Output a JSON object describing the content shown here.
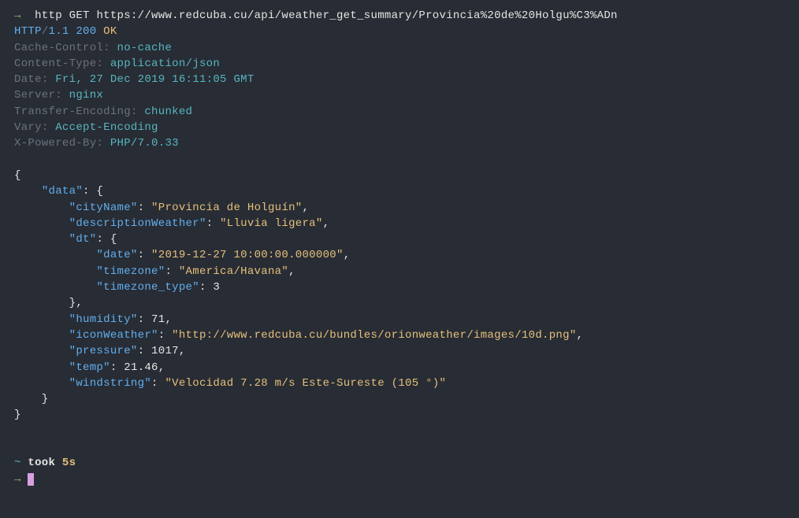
{
  "command": {
    "prompt_arrow": "→",
    "tool": "http",
    "method": "GET",
    "url": "https://www.redcuba.cu/api/weather_get_summary/Provincia%20de%20Holgu%C3%ADn"
  },
  "status_line": {
    "protocol": "HTTP",
    "slash": "/",
    "version": "1.1",
    "code": "200",
    "reason": "OK"
  },
  "headers": {
    "cache_control": {
      "key": "Cache-Control",
      "value": "no-cache"
    },
    "content_type": {
      "key": "Content-Type",
      "value": "application/json"
    },
    "date": {
      "key": "Date",
      "value": "Fri, 27 Dec 2019 16:11:05 GMT"
    },
    "server": {
      "key": "Server",
      "value": "nginx"
    },
    "transfer_encoding": {
      "key": "Transfer-Encoding",
      "value": "chunked"
    },
    "vary": {
      "key": "Vary",
      "value": "Accept-Encoding"
    },
    "x_powered_by": {
      "key": "X-Powered-By",
      "value": "PHP/7.0.33"
    }
  },
  "body": {
    "open_brace": "{",
    "close_brace": "}",
    "indent1": "    ",
    "indent2": "        ",
    "indent3": "            ",
    "data_key": "\"data\"",
    "colon_brace": ": {",
    "cityName_key": "\"cityName\"",
    "cityName_val": "\"Provincia de Holguín\"",
    "descWeather_key": "\"descriptionWeather\"",
    "descWeather_val": "\"Lluvia ligera\"",
    "dt_key": "\"dt\"",
    "date_key": "\"date\"",
    "date_val": "\"2019-12-27 10:00:00.000000\"",
    "timezone_key": "\"timezone\"",
    "timezone_val": "\"America/Havana\"",
    "timezone_type_key": "\"timezone_type\"",
    "timezone_type_val": "3",
    "close_brace_comma": "},",
    "humidity_key": "\"humidity\"",
    "humidity_val": "71",
    "iconWeather_key": "\"iconWeather\"",
    "iconWeather_val": "\"http://www.redcuba.cu/bundles/orionweather/images/10d.png\"",
    "pressure_key": "\"pressure\"",
    "pressure_val": "1017",
    "temp_key": "\"temp\"",
    "temp_val": "21.46",
    "windstring_key": "\"windstring\"",
    "windstring_val": "\"Velocidad 7.28 m/s Este-Sureste (105 °)\"",
    "close_inner": "    }",
    "colon_sep": ": ",
    "comma": ","
  },
  "footer": {
    "tilde": "~",
    "took_label": "took",
    "duration": "5s",
    "prompt_arrow": "→"
  }
}
